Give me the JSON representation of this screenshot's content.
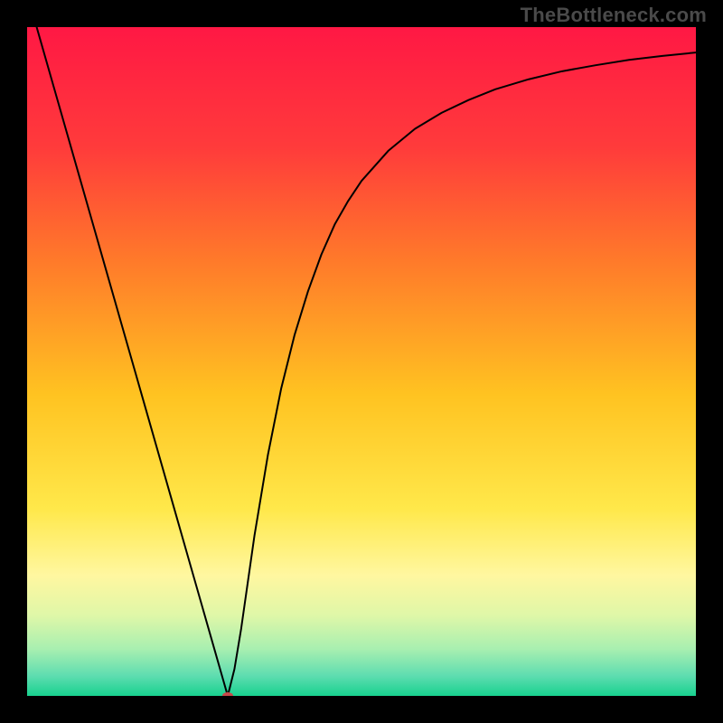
{
  "watermark": "TheBottleneck.com",
  "chart_data": {
    "type": "line",
    "title": "",
    "xlabel": "",
    "ylabel": "",
    "xlim": [
      0,
      100
    ],
    "ylim": [
      0,
      100
    ],
    "background_gradient": {
      "stops": [
        {
          "offset": 0.0,
          "color": "#ff1844"
        },
        {
          "offset": 0.18,
          "color": "#ff3b3b"
        },
        {
          "offset": 0.35,
          "color": "#ff7a2a"
        },
        {
          "offset": 0.55,
          "color": "#ffc321"
        },
        {
          "offset": 0.72,
          "color": "#ffe84a"
        },
        {
          "offset": 0.82,
          "color": "#fff7a0"
        },
        {
          "offset": 0.88,
          "color": "#dff7a8"
        },
        {
          "offset": 0.93,
          "color": "#a8efb0"
        },
        {
          "offset": 0.97,
          "color": "#5eddb0"
        },
        {
          "offset": 1.0,
          "color": "#18d18f"
        }
      ]
    },
    "curve": {
      "color": "#000000",
      "width": 2,
      "x": [
        0,
        2,
        4,
        6,
        8,
        10,
        12,
        14,
        16,
        18,
        20,
        22,
        24,
        25,
        26,
        27,
        28,
        29,
        30,
        31,
        32,
        33,
        34,
        35,
        36,
        38,
        40,
        42,
        44,
        46,
        48,
        50,
        54,
        58,
        62,
        66,
        70,
        75,
        80,
        85,
        90,
        95,
        100
      ],
      "y": [
        105,
        98,
        91,
        84,
        77,
        70,
        63,
        56,
        49,
        42,
        35,
        28,
        21,
        17.5,
        14,
        10.5,
        7,
        3.5,
        0,
        4,
        10,
        17,
        24,
        30,
        36,
        46,
        54,
        60.5,
        66,
        70.5,
        74,
        77,
        81.5,
        84.8,
        87.2,
        89.1,
        90.7,
        92.2,
        93.4,
        94.3,
        95.1,
        95.7,
        96.2
      ]
    },
    "marker": {
      "x": 30,
      "y": 0,
      "color": "#c64a4a",
      "rx": 6,
      "ry": 4
    }
  }
}
